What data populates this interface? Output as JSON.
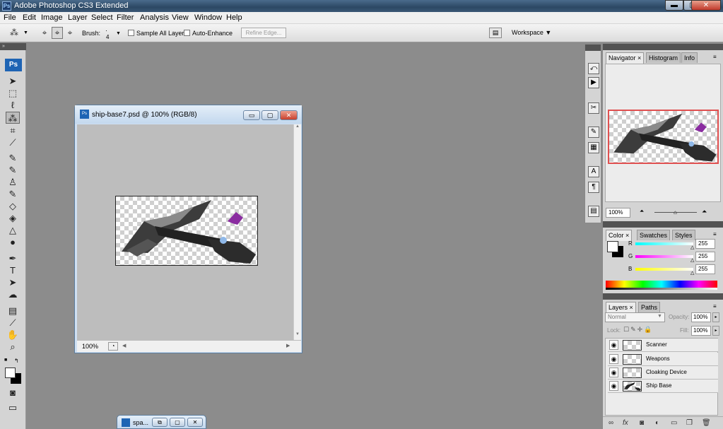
{
  "window": {
    "title": "Adobe Photoshop CS3 Extended",
    "logo": "Ps",
    "min": "▬",
    "max": "▢",
    "close": "✕"
  },
  "menu": [
    "File",
    "Edit",
    "Image",
    "Layer",
    "Select",
    "Filter",
    "Analysis",
    "View",
    "Window",
    "Help"
  ],
  "options": {
    "brush_label": "Brush:",
    "brush_size": "4",
    "sample_all_layers": "Sample All Layers",
    "auto_enhance": "Auto-Enhance",
    "refine_edge": "Refine Edge...",
    "workspace": "Workspace ▼"
  },
  "toolbox": {
    "logo": "Ps"
  },
  "document": {
    "title": "ship-base7.psd @ 100% (RGB/8)",
    "zoom": "100%",
    "min": "▭",
    "max": "▢",
    "close": "✕"
  },
  "minimized_doc": {
    "title": "spa...",
    "restore": "⧉",
    "max": "▢",
    "close": "✕"
  },
  "navigator": {
    "tabs": [
      "Navigator ×",
      "Histogram",
      "Info"
    ],
    "zoom": "100%"
  },
  "color": {
    "tabs": [
      "Color ×",
      "Swatches",
      "Styles"
    ],
    "r_label": "R",
    "g_label": "G",
    "b_label": "B",
    "r": "255",
    "g": "255",
    "b": "255",
    "r_fraction": 1.0,
    "g_fraction": 1.0,
    "b_fraction": 1.0
  },
  "layers": {
    "tabs": [
      "Layers ×",
      "Paths"
    ],
    "blend_mode": "Normal",
    "opacity_label": "Opacity:",
    "opacity": "100%",
    "lock_label": "Lock:",
    "fill_label": "Fill:",
    "fill": "100%",
    "items": [
      {
        "name": "Scanner"
      },
      {
        "name": "Weapons"
      },
      {
        "name": "Cloaking Device"
      },
      {
        "name": "Ship Base"
      }
    ]
  },
  "colors": {
    "workspace": "#8c8c8c",
    "panel": "#d4d4d4",
    "accent": "#1e64b4",
    "close": "#c8402d"
  }
}
